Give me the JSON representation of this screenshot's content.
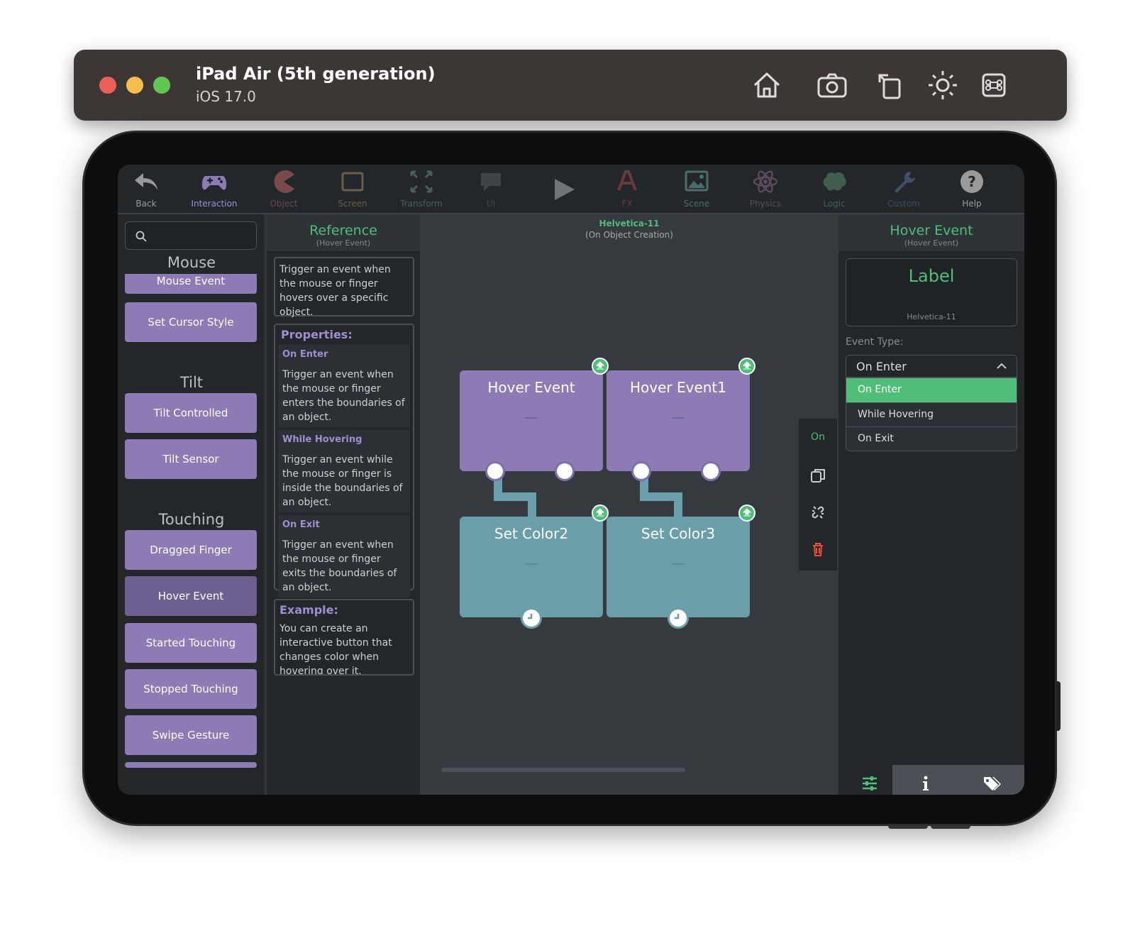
{
  "window": {
    "device_name": "iPad Air (5th generation)",
    "os_version": "iOS 17.0",
    "toolbar_icons": [
      "home-icon",
      "screenshot-icon",
      "rotate-icon",
      "brightness-icon",
      "command-icon"
    ]
  },
  "toolbar": {
    "items": [
      {
        "label": "Back",
        "icon": "back-arrow-icon"
      },
      {
        "label": "Interaction",
        "icon": "gamepad-icon"
      },
      {
        "label": "Object",
        "icon": "pacman-icon"
      },
      {
        "label": "Screen",
        "icon": "screen-icon"
      },
      {
        "label": "Transform",
        "icon": "transform-icon"
      },
      {
        "label": "UI",
        "icon": "speech-bubble-icon"
      },
      {
        "label": "FX",
        "icon": "fx-icon"
      },
      {
        "label": "Scene",
        "icon": "image-icon"
      },
      {
        "label": "Physics",
        "icon": "atom-icon"
      },
      {
        "label": "Logic",
        "icon": "brain-icon"
      },
      {
        "label": "Custom",
        "icon": "wrench-icon"
      },
      {
        "label": "Help",
        "icon": "help-icon"
      }
    ],
    "play_icon": "play-icon"
  },
  "library": {
    "sections": [
      {
        "title": "Mouse",
        "items": [
          "Mouse Event",
          "Set Cursor Style"
        ]
      },
      {
        "title": "Tilt",
        "items": [
          "Tilt Controlled",
          "Tilt Sensor"
        ]
      },
      {
        "title": "Touching",
        "items": [
          "Dragged Finger",
          "Hover Event",
          "Started Touching",
          "Stopped Touching",
          "Swipe Gesture"
        ]
      }
    ]
  },
  "reference": {
    "title": "Reference",
    "subtitle": "(Hover Event)",
    "description": "Trigger an event when the mouse or finger hovers over a specific object.",
    "properties_title": "Properties:",
    "properties": [
      {
        "name": "On Enter",
        "text": "Trigger an event when the mouse or finger enters the boundaries of an object."
      },
      {
        "name": "While Hovering",
        "text": "Trigger an event while the mouse or finger is inside the boundaries of an object."
      },
      {
        "name": "On Exit",
        "text": "Trigger an event when the mouse or finger exits the boundaries of an object."
      }
    ],
    "example_title": "Example:",
    "example_text": "You can create an interactive button that changes color when hovering over it."
  },
  "canvas": {
    "object_name": "Helvetica-11",
    "object_context": "(On Object Creation)",
    "nodes": [
      {
        "title": "Hover Event",
        "kind": "event"
      },
      {
        "title": "Hover Event1",
        "kind": "event"
      },
      {
        "title": "Set Color2",
        "kind": "action"
      },
      {
        "title": "Set Color3",
        "kind": "action"
      }
    ],
    "context_menu": {
      "on_label": "On"
    }
  },
  "inspector": {
    "title": "Hover Event",
    "subtitle": "(Hover Event)",
    "preview_label": "Label",
    "preview_font": "Helvetica-11",
    "event_type_label": "Event Type:",
    "event_type_value": "On Enter",
    "options": [
      "On Enter",
      "While Hovering",
      "On Exit"
    ],
    "selected_option": "On Enter",
    "tabs": [
      "sliders-icon",
      "info-icon",
      "tags-icon"
    ]
  },
  "colors": {
    "accent_green": "#4fbe79",
    "block_purple": "#8c7bb5",
    "block_teal": "#6a9faa",
    "delete_red": "#e8503a"
  }
}
